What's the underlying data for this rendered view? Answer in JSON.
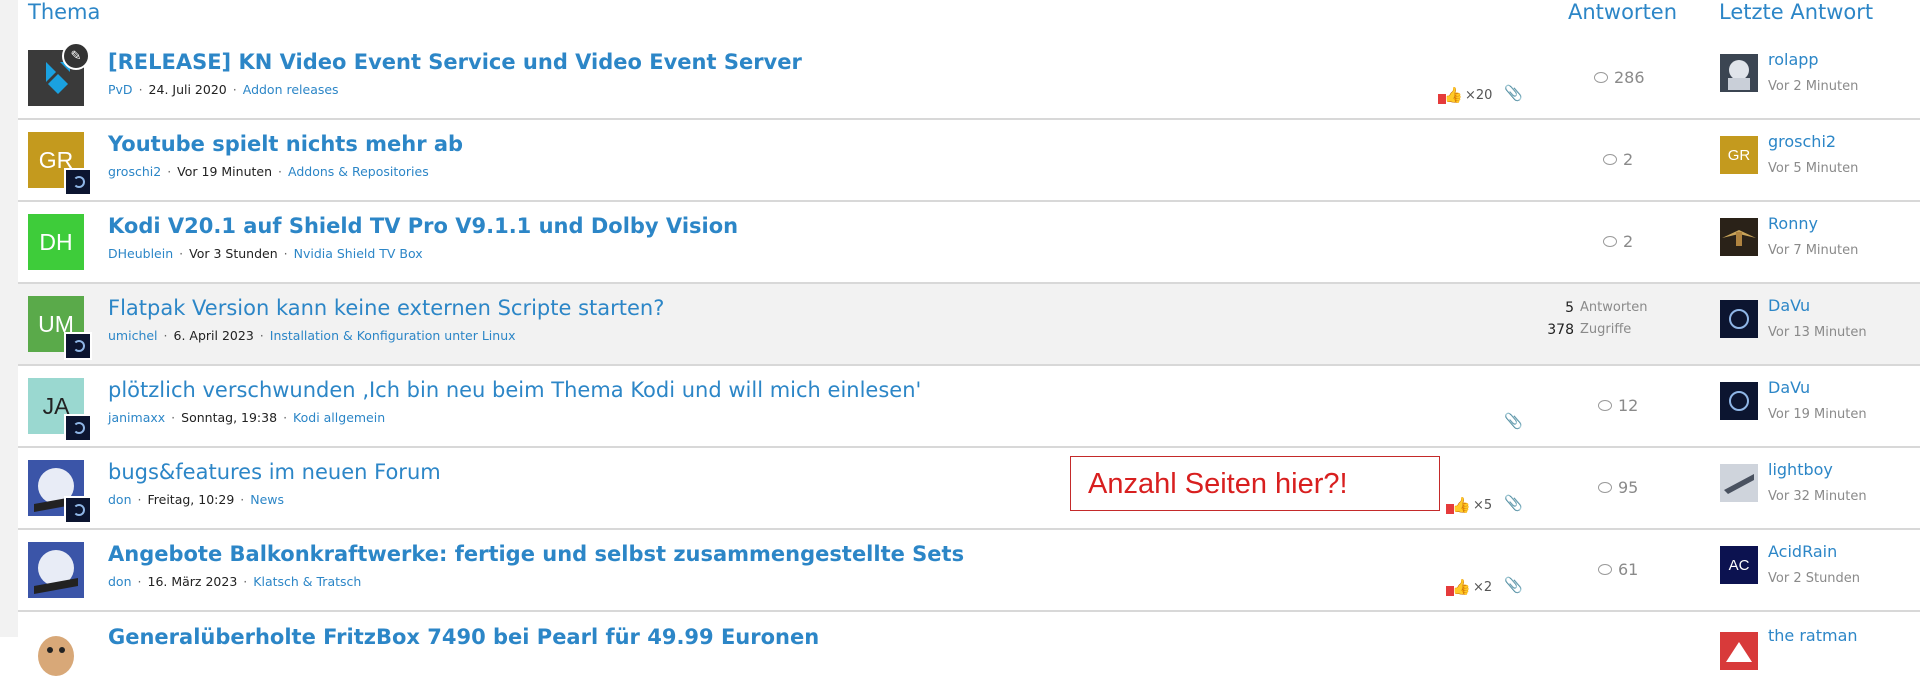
{
  "header": {
    "thema": "Thema",
    "antworten": "Antworten",
    "letzte_antwort": "Letzte Antwort"
  },
  "threads": [
    {
      "avatar_initials": "",
      "avatar_color": "#3a3a3a",
      "title": "[RELEASE] KN Video Event Service und Video Event Server",
      "author": "PvD",
      "date": "24. Juli 2020",
      "forum": "Addon releases",
      "likes": "×20",
      "replies": "286",
      "last_user": "rolapp",
      "last_time": "Vor 2 Minuten"
    },
    {
      "avatar_initials": "GR",
      "avatar_color": "#c49a1e",
      "title": "Youtube spielt nichts mehr ab",
      "author": "groschi2",
      "date": "Vor 19 Minuten",
      "forum": "Addons & Repositories",
      "replies": "2",
      "last_user": "groschi2",
      "last_time": "Vor 5 Minuten",
      "last_avatar_initials": "GR"
    },
    {
      "avatar_initials": "DH",
      "avatar_color": "#3ecc3a",
      "title": "Kodi V20.1 auf Shield TV Pro V9.1.1 und Dolby Vision",
      "author": "DHeublein",
      "date": "Vor 3 Stunden",
      "forum": "Nvidia Shield TV Box",
      "replies": "2",
      "last_user": "Ronny",
      "last_time": "Vor 7 Minuten"
    },
    {
      "avatar_initials": "UM",
      "avatar_color": "#5aaa4a",
      "title": "Flatpak Version kann keine externen Scripte starten?",
      "author": "umichel",
      "date": "6. April 2023",
      "forum": "Installation & Konfiguration unter Linux",
      "stats": {
        "antworten_num": "5",
        "antworten_label": "Antworten",
        "zugriffe_num": "378",
        "zugriffe_label": "Zugriffe"
      },
      "last_user": "DaVu",
      "last_time": "Vor 13 Minuten"
    },
    {
      "avatar_initials": "JA",
      "avatar_color": "#9ad8d0",
      "title": "plötzlich verschwunden ‚Ich bin neu beim Thema Kodi und will mich einlesen'",
      "author": "janimaxx",
      "date": "Sonntag, 19:38",
      "forum": "Kodi allgemein",
      "replies": "12",
      "last_user": "DaVu",
      "last_time": "Vor 19 Minuten"
    },
    {
      "avatar_initials": "",
      "avatar_color": "#3b55a8",
      "title": "bugs&features im neuen Forum",
      "author": "don",
      "date": "Freitag, 10:29",
      "forum": "News",
      "likes": "×5",
      "replies": "95",
      "last_user": "lightboy",
      "last_time": "Vor 32 Minuten"
    },
    {
      "avatar_initials": "",
      "avatar_color": "#3b55a8",
      "title": "Angebote Balkonkraftwerke: fertige und selbst zusammengestellte Sets",
      "author": "don",
      "date": "16. März 2023",
      "forum": "Klatsch & Tratsch",
      "likes": "×2",
      "replies": "61",
      "last_user": "AcidRain",
      "last_time": "Vor 2 Stunden",
      "last_avatar_initials": "AC"
    },
    {
      "title": "Generalüberholte FritzBox 7490 bei Pearl für 49.99 Euronen",
      "last_user": "the ratman"
    }
  ],
  "annotation": "Anzahl Seiten hier?!"
}
